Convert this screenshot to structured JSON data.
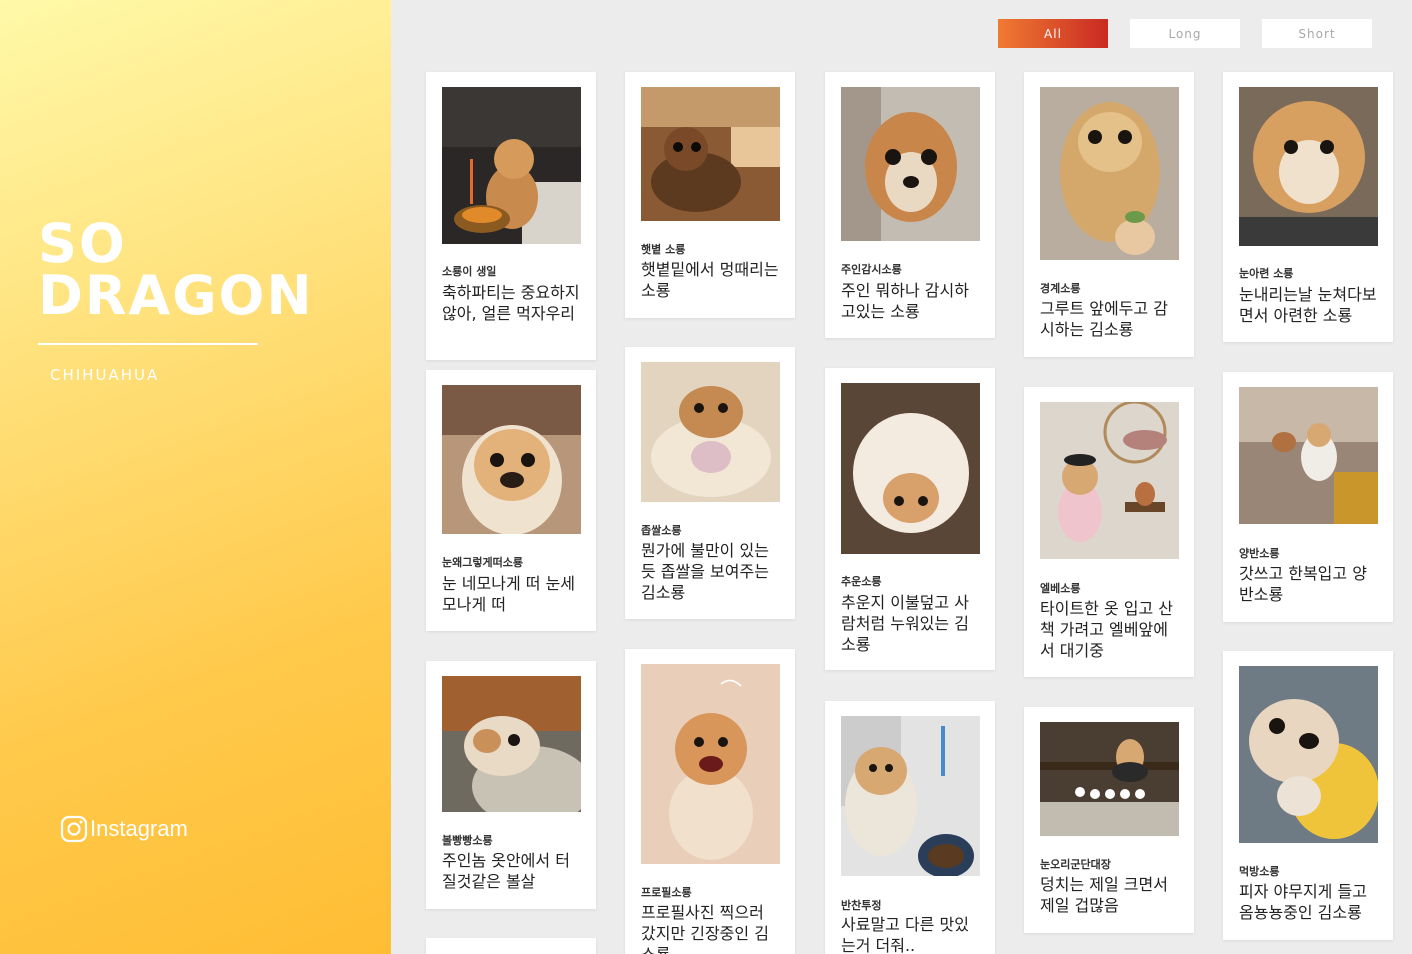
{
  "sidebar": {
    "logo_line1": "SO",
    "logo_line2": "DRAGON",
    "subtitle": "CHIHUAHUA",
    "instagram_label": "Instagram"
  },
  "filters": {
    "all": "All",
    "long": "Long",
    "short": "Short",
    "active": "All"
  },
  "colors": {
    "accent_start": "#f07a32",
    "accent_end": "#c92a22",
    "sidebar_top": "#fff9a8",
    "sidebar_bottom": "#ffbd34"
  },
  "cards": [
    {
      "tag": "소룡이 생일",
      "desc": "축하파티는 중요하지 않아, 얼른 먹자우리"
    },
    {
      "tag": "햇볕 소룡",
      "desc": "햇볕밑에서 멍때리는 소룡"
    },
    {
      "tag": "주인감시소룡",
      "desc": "주인 뭐하나 감시하고있는 소룡"
    },
    {
      "tag": "경계소룡",
      "desc": "그루트 앞에두고 감시하는 김소룡"
    },
    {
      "tag": "눈아련 소룡",
      "desc": "눈내리는날 눈쳐다보면서 아련한 소룡"
    },
    {
      "tag": "눈왜그렇게떠소룡",
      "desc": "눈 네모나게 떠 눈세모나게 떠"
    },
    {
      "tag": "좁쌀소룡",
      "desc": "뭔가에 불만이 있는듯 좁쌀을 보여주는 김소룡"
    },
    {
      "tag": "추운소룡",
      "desc": "추운지 이불덮고 사람처럼 누워있는 김소룡"
    },
    {
      "tag": "엘베소룡",
      "desc": "타이트한 옷 입고 산책 가려고 엘베앞에서 대기중"
    },
    {
      "tag": "양반소룡",
      "desc": "갓쓰고 한복입고 양반소룡"
    },
    {
      "tag": "볼빵빵소룡",
      "desc": "주인놈 옷안에서 터질것같은 볼살"
    },
    {
      "tag": "프로필소룡",
      "desc": "프로필사진 찍으러 갔지만 긴장중인 김소룡"
    },
    {
      "tag": "반찬투정",
      "desc": "사료말고 다른 맛있는거 더줘.."
    },
    {
      "tag": "눈오리군단대장",
      "desc": "덩치는 제일 크면서 제일 겁많음"
    },
    {
      "tag": "먹방소룡",
      "desc": "피자 야무지게 들고 옴뇽뇽중인 김소룡"
    }
  ]
}
